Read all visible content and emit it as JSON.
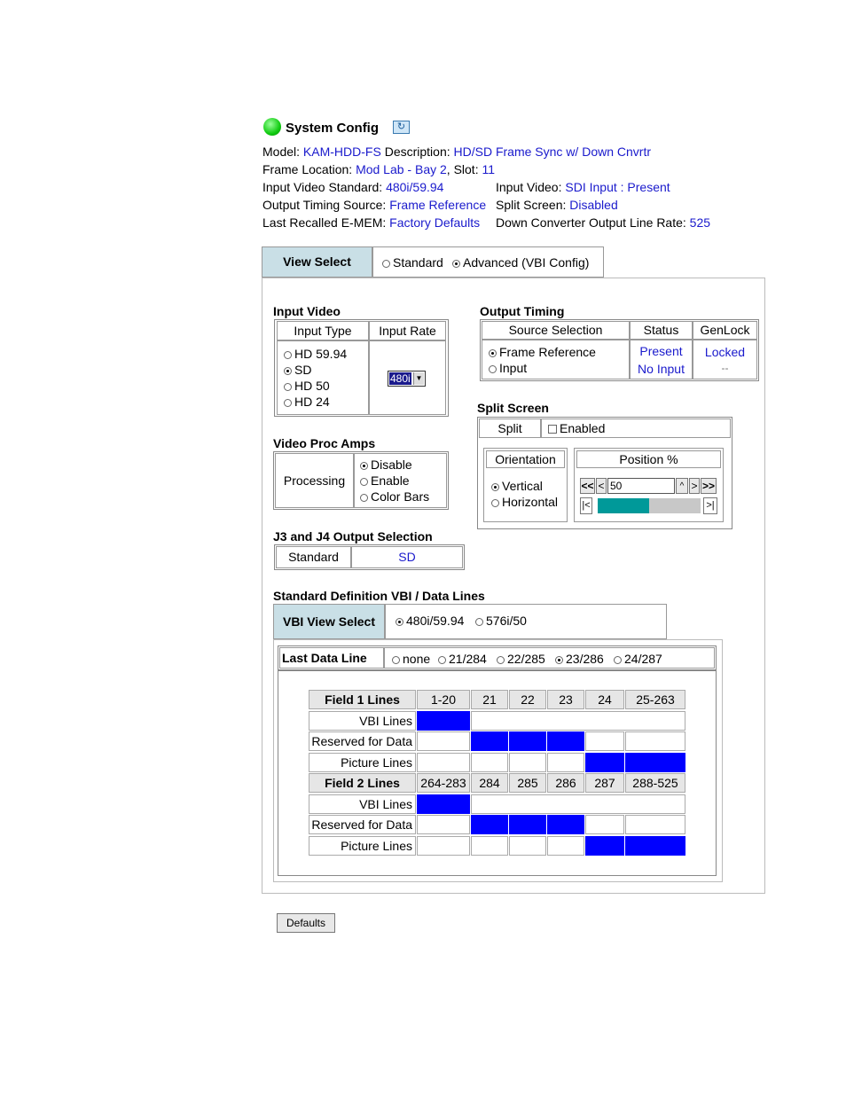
{
  "header": {
    "title": "System Config",
    "model_label": "Model:",
    "model_value": "KAM-HDD-FS",
    "desc_label": "Description:",
    "desc_value": "HD/SD Frame Sync w/ Down Cnvrtr",
    "frame_loc_label": "Frame Location:",
    "frame_loc_value": "Mod Lab - Bay 2",
    "slot_label": ", Slot:",
    "slot_value": "11",
    "ivs_label": "Input Video Standard:",
    "ivs_value": "480i/59.94",
    "iv_label": "Input Video:",
    "iv_value": "SDI Input : Present",
    "ots_label": "Output Timing Source:",
    "ots_value": "Frame Reference",
    "split_label": "Split Screen:",
    "split_value": "Disabled",
    "emem_label": "Last Recalled E-MEM:",
    "emem_value": "Factory Defaults",
    "dc_label": "Down Converter Output Line Rate:",
    "dc_value": "525"
  },
  "view_select": {
    "label": "View Select",
    "options": [
      "Standard",
      "Advanced (VBI Config)"
    ],
    "selected": "Advanced (VBI Config)"
  },
  "input_video": {
    "title": "Input Video",
    "col_type": "Input Type",
    "col_rate": "Input Rate",
    "types": [
      "HD 59.94",
      "SD",
      "HD 50",
      "HD 24"
    ],
    "selected_type": "SD",
    "rate_value": "480i"
  },
  "output_timing": {
    "title": "Output Timing",
    "col_source": "Source Selection",
    "col_status": "Status",
    "col_genlock": "GenLock",
    "rows": [
      {
        "source": "Frame Reference",
        "status": "Present",
        "genlock": "Locked"
      },
      {
        "source": "Input",
        "status": "No Input",
        "genlock": "--"
      }
    ],
    "selected_source": "Frame Reference"
  },
  "split_screen": {
    "title": "Split Screen",
    "split_label": "Split",
    "enabled_label": "Enabled",
    "orientation_label": "Orientation",
    "orientations": [
      "Vertical",
      "Horizontal"
    ],
    "selected_orientation": "Vertical",
    "position_label": "Position %",
    "position_value": "50",
    "position_fraction": 0.5,
    "btn_ll": "<<",
    "btn_l": "<",
    "btn_r": ">",
    "btn_rr": ">>",
    "btn_start": "|<",
    "btn_end": ">|",
    "spin": "^",
    "slider_color": "#009999"
  },
  "video_proc": {
    "title": "Video Proc Amps",
    "label": "Processing",
    "options": [
      "Disable",
      "Enable",
      "Color Bars"
    ],
    "selected": "Disable"
  },
  "j3j4": {
    "title": "J3 and J4 Output Selection",
    "label": "Standard",
    "value": "SD"
  },
  "vbi": {
    "title": "Standard Definition VBI / Data Lines",
    "view_label": "VBI View Select",
    "view_options": [
      "480i/59.94",
      "576i/50"
    ],
    "view_selected": "480i/59.94",
    "last_label": "Last Data Line",
    "last_options": [
      "none",
      "21/284",
      "22/285",
      "23/286",
      "24/287"
    ],
    "last_selected": "23/286",
    "fill_color": "#0000ff",
    "field1_header": "Field 1 Lines",
    "field1_cols": [
      "1-20",
      "21",
      "22",
      "23",
      "24",
      "25-263"
    ],
    "field2_header": "Field 2 Lines",
    "field2_cols": [
      "264-283",
      "284",
      "285",
      "286",
      "287",
      "288-525"
    ],
    "row_labels": [
      "VBI Lines",
      "Reserved for Data",
      "Picture Lines"
    ]
  },
  "defaults_button": "Defaults"
}
